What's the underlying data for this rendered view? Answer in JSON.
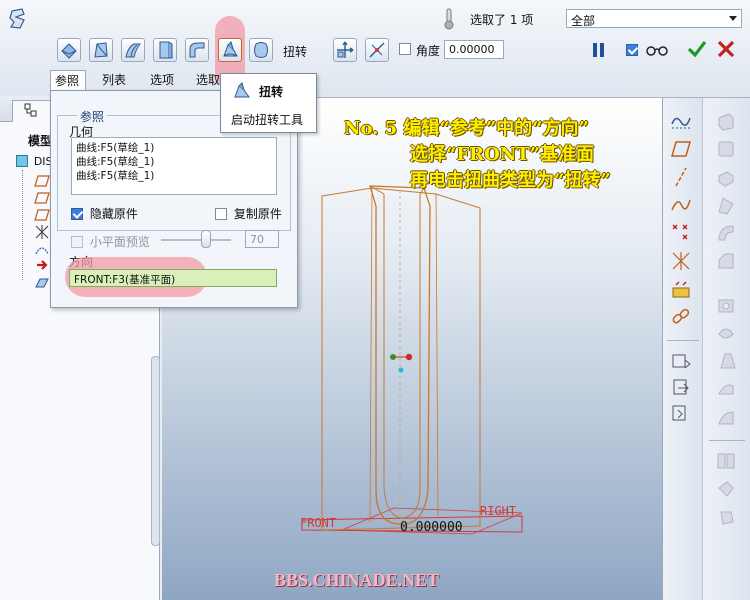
{
  "toolbar": {
    "selection_count": "选取了 1 项",
    "filter_value": "全部",
    "twist_label": "扭转",
    "angle_label": "角度",
    "angle_value": "0.00000"
  },
  "tabs": [
    {
      "label": "参照"
    },
    {
      "label": "列表"
    },
    {
      "label": "选项"
    },
    {
      "label": "选取"
    }
  ],
  "tooltip": {
    "title": "扭转",
    "description": "启动扭转工具"
  },
  "ref_panel": {
    "group_title": "参照",
    "geometry_label": "几何",
    "geometry_items": [
      "曲线:F5(草绘_1)",
      "曲线:F5(草绘_1)",
      "曲线:F5(草绘_1)"
    ],
    "hide_original_label": "隐藏原件",
    "copy_original_label": "复制原件",
    "small_preview_label": "小平面预览",
    "slider_value": "70",
    "direction_label": "方向",
    "direction_value": "FRONT:F3(基准平面)"
  },
  "tree": {
    "tab_label": "模型",
    "root_label": "DIS"
  },
  "annotation": {
    "line1": "No. 5 编辑“参考”中的“方向”",
    "line2": "选择“FRONT”基准面",
    "line3": "再电击扭曲类型为“扭转”"
  },
  "viewport": {
    "front_label": "FRONT",
    "right_label": "RIGHT",
    "dimension_value": "0.000000",
    "watermark": "BBS.CHINADE.NET"
  },
  "colors": {
    "accent_orange": "#c8782a",
    "highlight_pink": "#f29aa5",
    "annotation_yellow": "#ffee00",
    "datum_red": "#d23a3a"
  }
}
